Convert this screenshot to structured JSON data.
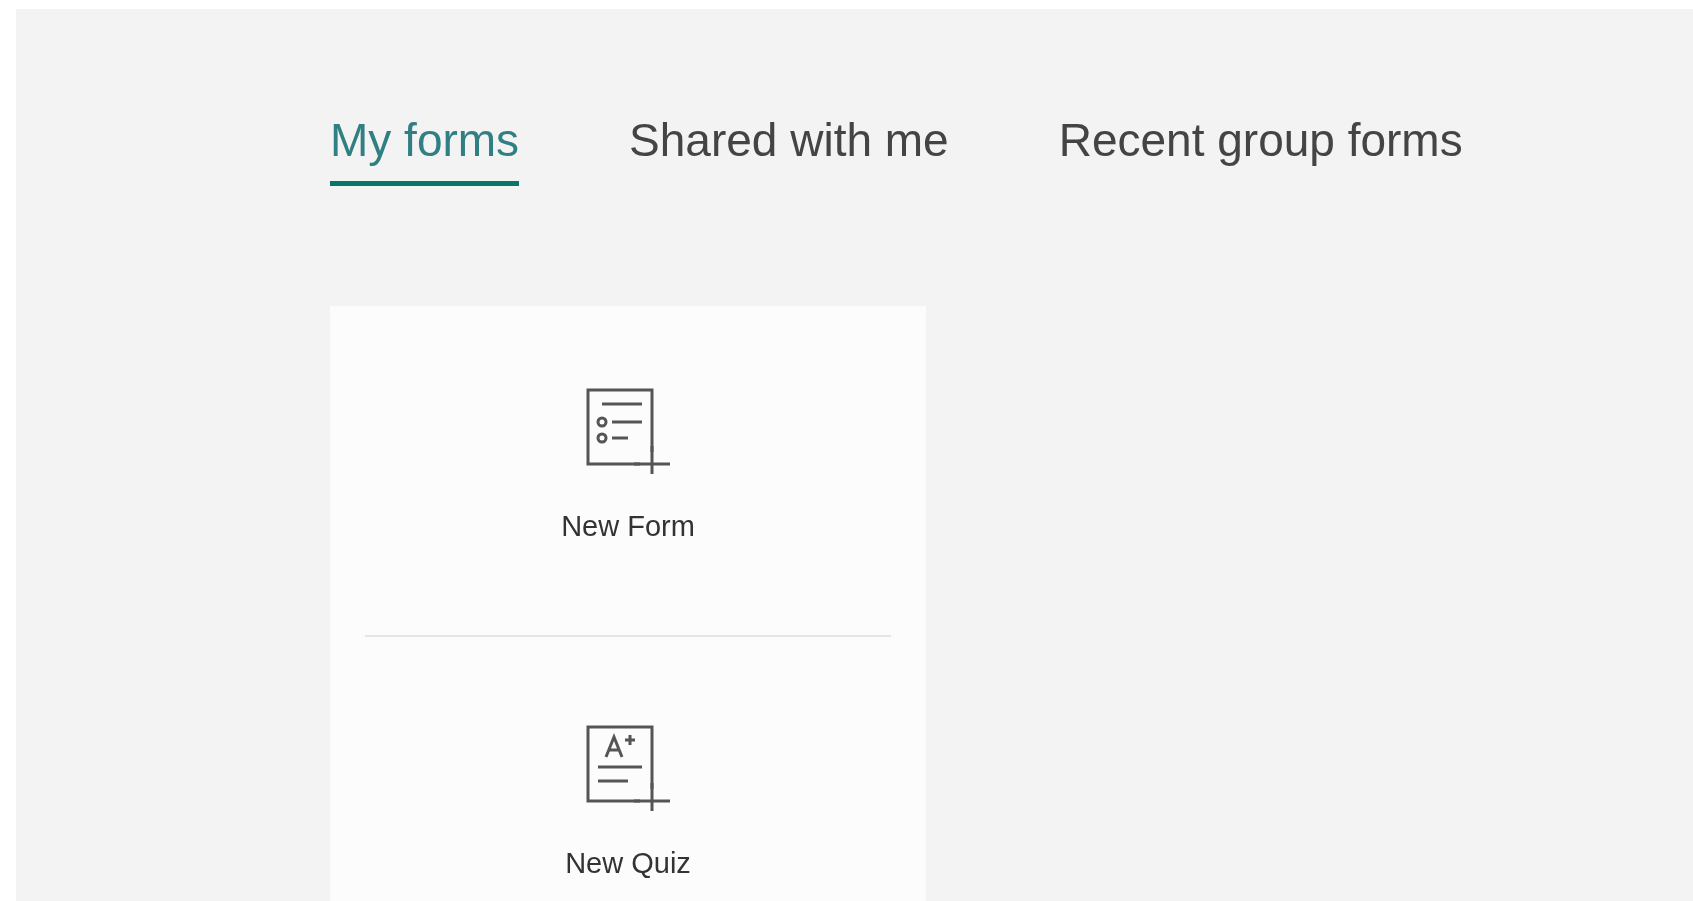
{
  "tabs": [
    {
      "label": "My forms",
      "selected": true
    },
    {
      "label": "Shared with me",
      "selected": false
    },
    {
      "label": "Recent group forms",
      "selected": false
    }
  ],
  "new_items": [
    {
      "kind": "form",
      "label": "New Form"
    },
    {
      "kind": "quiz",
      "label": "New Quiz"
    }
  ]
}
